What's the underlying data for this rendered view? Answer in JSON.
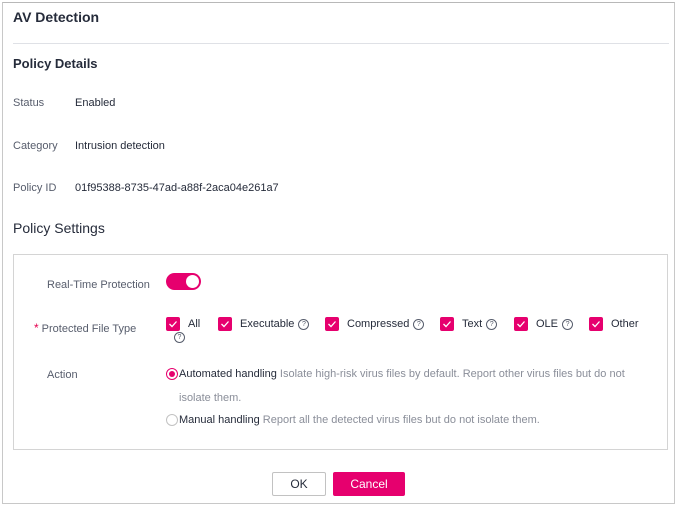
{
  "dialog": {
    "title": "AV Detection"
  },
  "policy_details": {
    "heading": "Policy Details",
    "rows": [
      {
        "label": "Status",
        "value": "Enabled"
      },
      {
        "label": "Category",
        "value": "Intrusion detection"
      },
      {
        "label": "Policy ID",
        "value": "01f95388-8735-47ad-a88f-2aca04e261a7"
      }
    ]
  },
  "policy_settings": {
    "heading": "Policy Settings",
    "real_time_protection": {
      "label": "Real-Time Protection",
      "enabled": true
    },
    "protected_file_type": {
      "label": "Protected File Type",
      "required_mark": "*",
      "options": [
        {
          "label": "All",
          "checked": true,
          "help": true
        },
        {
          "label": "Executable",
          "checked": true,
          "help": true
        },
        {
          "label": "Compressed",
          "checked": true,
          "help": true
        },
        {
          "label": "Text",
          "checked": true,
          "help": true
        },
        {
          "label": "OLE",
          "checked": true,
          "help": true
        },
        {
          "label": "Other",
          "checked": true,
          "help": false
        }
      ]
    },
    "action": {
      "label": "Action",
      "options": [
        {
          "label": "Automated handling",
          "desc_line1": "Isolate high-risk virus files by default. Report other virus files but do not",
          "desc_line2": "isolate them.",
          "selected": true
        },
        {
          "label": "Manual handling",
          "desc_line1": "Report all the detected virus files but do not isolate them.",
          "selected": false
        }
      ]
    }
  },
  "footer": {
    "ok_label": "OK",
    "cancel_label": "Cancel"
  },
  "colors": {
    "accent": "#e6006e",
    "border": "#d4d4d4",
    "muted_text": "#8a8e99"
  },
  "icons": {
    "help": "?"
  }
}
